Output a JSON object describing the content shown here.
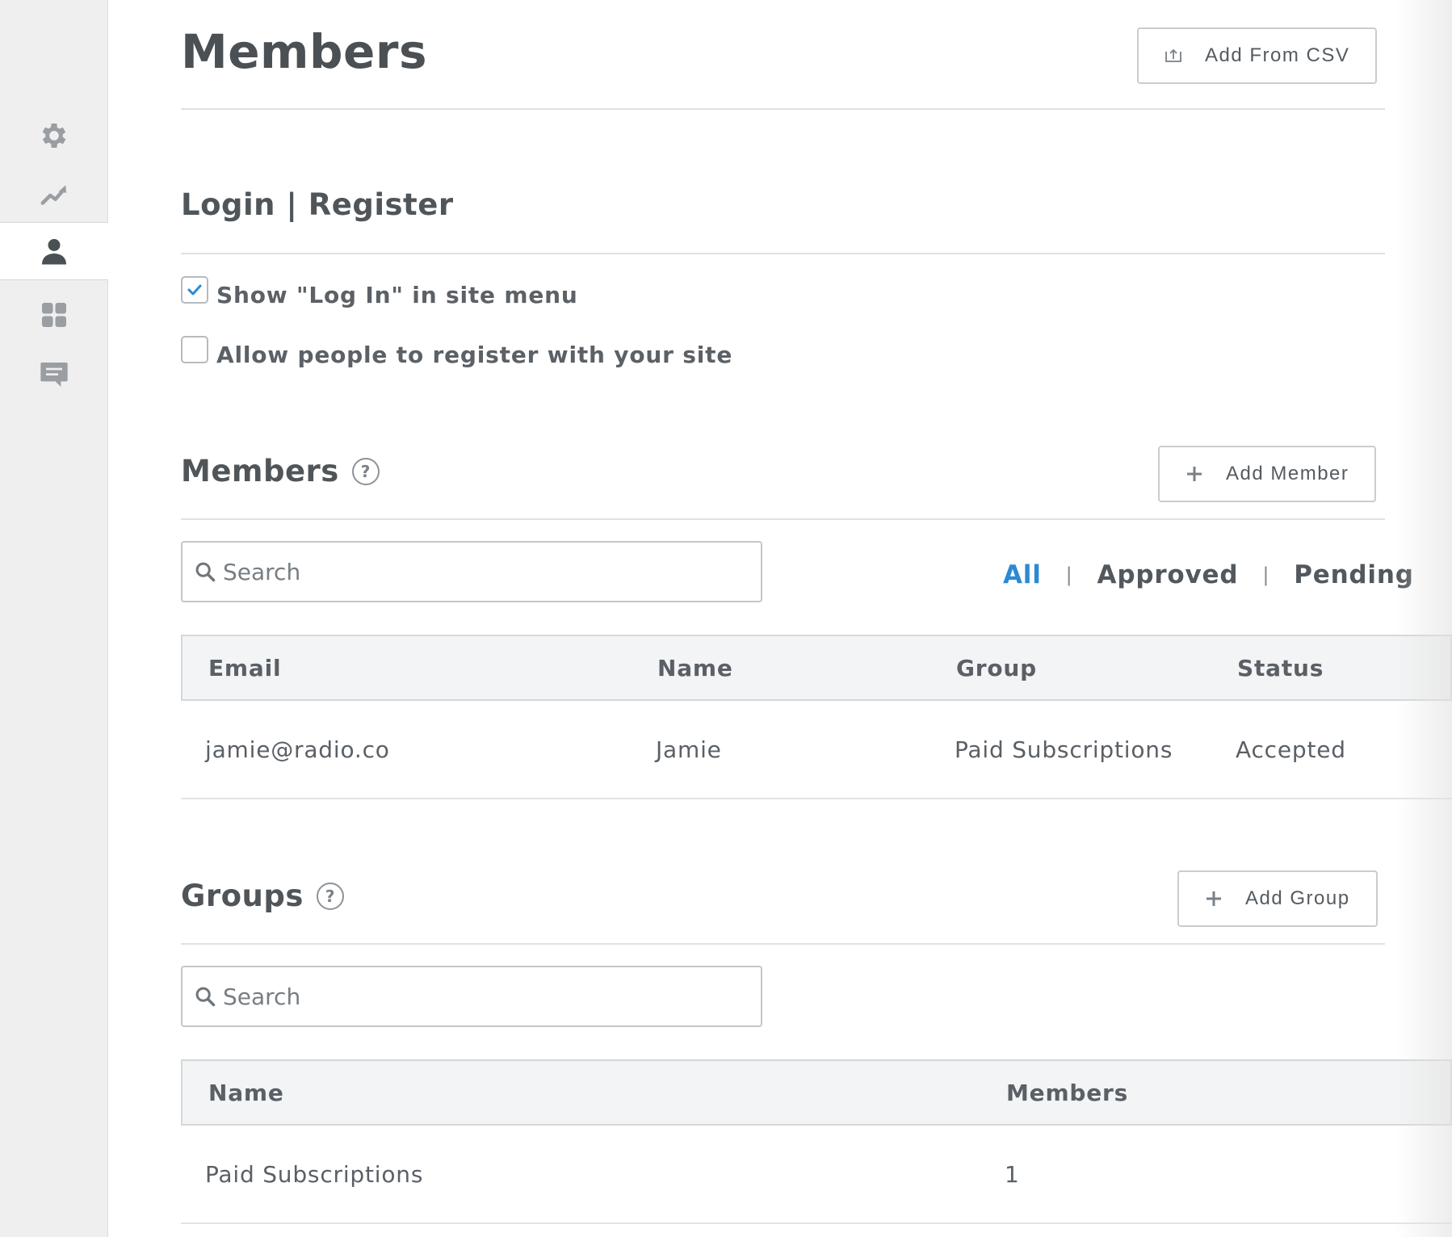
{
  "sidebar": {
    "items": [
      {
        "name": "settings",
        "icon": "gear-icon",
        "active": false
      },
      {
        "name": "analytics",
        "icon": "trending-up-icon",
        "active": false
      },
      {
        "name": "members",
        "icon": "person-icon",
        "active": true
      },
      {
        "name": "apps",
        "icon": "grid-icon",
        "active": false
      },
      {
        "name": "comments",
        "icon": "chat-icon",
        "active": false
      }
    ],
    "icon_color": "#9a9ea2",
    "active_icon_color": "#4a5054"
  },
  "header": {
    "title": "Members",
    "add_csv_label": "Add From CSV"
  },
  "login_register": {
    "title": "Login | Register",
    "options": [
      {
        "label": "Show \"Log In\" in site menu",
        "checked": true
      },
      {
        "label": "Allow people to register with your site",
        "checked": false
      }
    ]
  },
  "members_section": {
    "title": "Members",
    "help": "?",
    "add_label": "Add Member",
    "search_placeholder": "Search",
    "filters": {
      "all": "All",
      "approved": "Approved",
      "pending": "Pending",
      "separator": "|",
      "active": "All"
    },
    "columns": {
      "email": "Email",
      "name": "Name",
      "group": "Group",
      "status": "Status"
    },
    "rows": [
      {
        "email": "jamie@radio.co",
        "name": "Jamie",
        "group": "Paid Subscriptions",
        "status": "Accepted"
      }
    ]
  },
  "groups_section": {
    "title": "Groups",
    "help": "?",
    "add_label": "Add Group",
    "search_placeholder": "Search",
    "columns": {
      "name": "Name",
      "members": "Members"
    },
    "rows": [
      {
        "name": "Paid Subscriptions",
        "members": "1"
      }
    ]
  },
  "colors": {
    "accent": "#2a8ad4",
    "text": "#4f5559",
    "border": "#c9cdd0"
  }
}
